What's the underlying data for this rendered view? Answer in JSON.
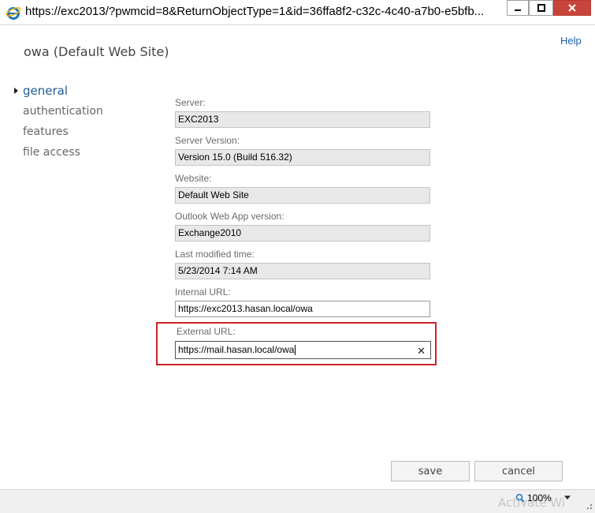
{
  "window": {
    "title_url": "https://exc2013/?pwmcid=8&ReturnObjectType=1&id=36ffa8f2-c32c-4c40-a7b0-e5bfb..."
  },
  "header": {
    "help_label": "Help",
    "page_title": "owa (Default Web Site)"
  },
  "nav": {
    "items": [
      {
        "label": "general",
        "active": true
      },
      {
        "label": "authentication",
        "active": false
      },
      {
        "label": "features",
        "active": false
      },
      {
        "label": "file access",
        "active": false
      }
    ]
  },
  "form": {
    "server": {
      "label": "Server:",
      "value": "EXC2013"
    },
    "server_version": {
      "label": "Server Version:",
      "value": "Version 15.0 (Build 516.32)"
    },
    "website": {
      "label": "Website:",
      "value": "Default Web Site"
    },
    "owa_version": {
      "label": "Outlook Web App version:",
      "value": "Exchange2010"
    },
    "last_modified": {
      "label": "Last modified time:",
      "value": "5/23/2014 7:14 AM"
    },
    "internal_url": {
      "label": "Internal URL:",
      "value": "https://exc2013.hasan.local/owa"
    },
    "external_url": {
      "label": "External URL:",
      "value": "https://mail.hasan.local/owa"
    }
  },
  "buttons": {
    "save": "save",
    "cancel": "cancel"
  },
  "statusbar": {
    "zoom": "100%",
    "watermark": "Activate Wi"
  },
  "colors": {
    "highlight_border": "#c8242b",
    "nav_active": "#1f5b95",
    "link": "#1a5fb4"
  },
  "icons": [
    "ie-logo-icon",
    "minimize-icon",
    "maximize-icon",
    "close-icon",
    "nav-arrow-icon",
    "clear-icon",
    "zoom-icon",
    "chevron-down-icon"
  ]
}
